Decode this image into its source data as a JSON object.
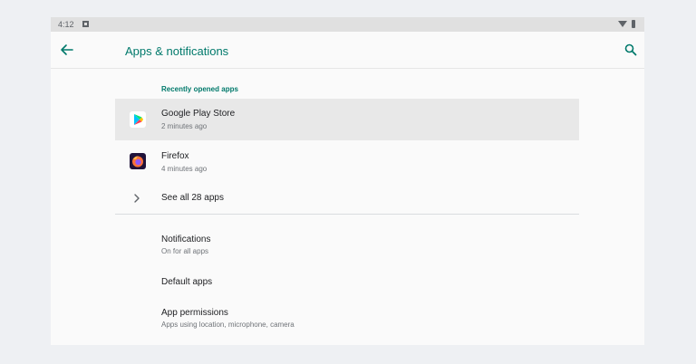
{
  "status_bar": {
    "time": "4:12",
    "notification_icon": "android-notification-icon",
    "wifi_icon": "wifi-icon",
    "battery_icon": "battery-icon"
  },
  "toolbar": {
    "title": "Apps & notifications",
    "back_icon": "arrow-back-icon",
    "search_icon": "search-icon"
  },
  "recent": {
    "header": "Recently opened apps",
    "apps": [
      {
        "name": "Google Play Store",
        "time": "2 minutes ago",
        "icon": "google-play-icon"
      },
      {
        "name": "Firefox",
        "time": "4 minutes ago",
        "icon": "firefox-icon"
      }
    ],
    "see_all": "See all 28 apps"
  },
  "prefs": [
    {
      "title": "Notifications",
      "subtitle": "On for all apps"
    },
    {
      "title": "Default apps",
      "subtitle": ""
    },
    {
      "title": "App permissions",
      "subtitle": "Apps using location, microphone, camera"
    }
  ],
  "colors": {
    "accent": "#00796b",
    "highlight_row": "#e8e8e8",
    "background": "#fafafa"
  }
}
